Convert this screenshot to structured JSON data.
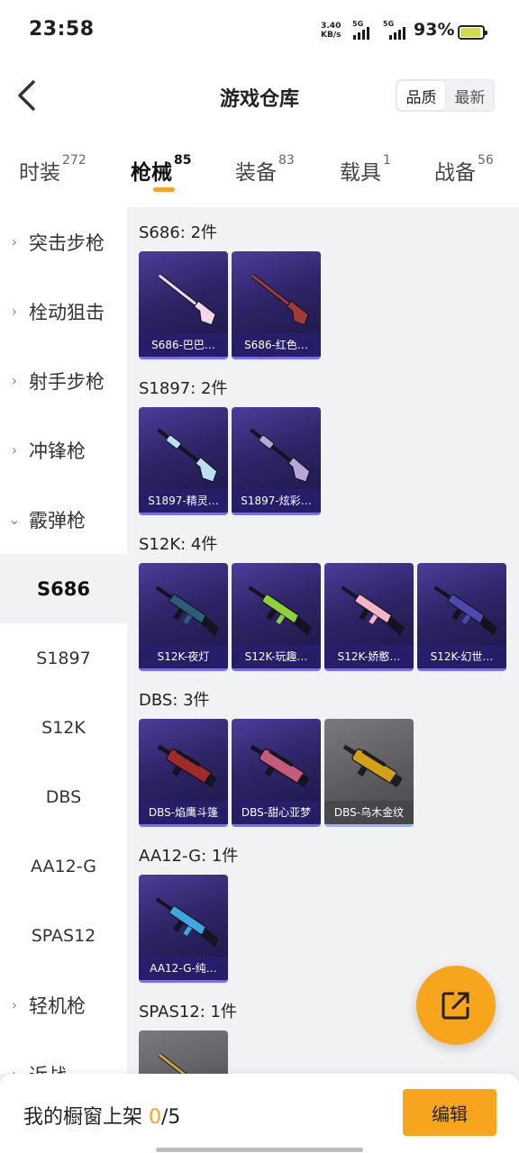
{
  "status_bar": {
    "time": "23:58",
    "net_speed": "3.40",
    "net_speed_unit": "KB/s",
    "sim1": "5G",
    "sim2": "5G",
    "battery_percent": "93%",
    "battery_level": 0.93
  },
  "header": {
    "title": "游戏仓库",
    "sort_options": [
      "品质",
      "最新"
    ],
    "active_sort": "品质"
  },
  "tabs": [
    {
      "label": "时装",
      "count": "272"
    },
    {
      "label": "枪械",
      "count": "85"
    },
    {
      "label": "装备",
      "count": "83"
    },
    {
      "label": "载具",
      "count": "1"
    },
    {
      "label": "战备",
      "count": "56"
    }
  ],
  "active_tab": "枪械",
  "sidebar": {
    "items": [
      {
        "label": "突击步枪",
        "type": "category",
        "expanded": false
      },
      {
        "label": "栓动狙击",
        "type": "category",
        "expanded": false
      },
      {
        "label": "射手步枪",
        "type": "category",
        "expanded": false
      },
      {
        "label": "冲锋枪",
        "type": "category",
        "expanded": false
      },
      {
        "label": "霰弹枪",
        "type": "category",
        "expanded": true
      },
      {
        "label": "S686",
        "type": "sub",
        "active": true
      },
      {
        "label": "S1897",
        "type": "sub",
        "active": false
      },
      {
        "label": "S12K",
        "type": "sub",
        "active": false
      },
      {
        "label": "DBS",
        "type": "sub",
        "active": false
      },
      {
        "label": "AA12-G",
        "type": "sub",
        "active": false
      },
      {
        "label": "SPAS12",
        "type": "sub",
        "active": false
      },
      {
        "label": "轻机枪",
        "type": "category",
        "expanded": false
      },
      {
        "label": "近战",
        "type": "category",
        "expanded": false
      }
    ]
  },
  "groups": [
    {
      "title": "S686: 2件",
      "items": [
        {
          "name": "S686-巴巴…",
          "tone": "purple",
          "gun": "shotgun",
          "color": "#f0d8e8"
        },
        {
          "name": "S686-红色…",
          "tone": "purple",
          "gun": "shotgun",
          "color": "#a33a3a"
        }
      ]
    },
    {
      "title": "S1897: 2件",
      "items": [
        {
          "name": "S1897-精灵…",
          "tone": "purple",
          "gun": "pump",
          "color": "#b8e0f0"
        },
        {
          "name": "S1897-炫彩…",
          "tone": "purple",
          "gun": "pump",
          "color": "#b7a6d8"
        }
      ]
    },
    {
      "title": "S12K: 4件",
      "items": [
        {
          "name": "S12K-夜灯",
          "tone": "purple",
          "gun": "rifle",
          "color": "#2e5d7a"
        },
        {
          "name": "S12K-玩趣…",
          "tone": "purple",
          "gun": "rifle",
          "color": "#8ed23a"
        },
        {
          "name": "S12K-娇憨…",
          "tone": "purple",
          "gun": "rifle",
          "color": "#f2b6c6"
        },
        {
          "name": "S12K-幻世…",
          "tone": "purple",
          "gun": "rifle",
          "color": "#4a4ab0"
        }
      ]
    },
    {
      "title": "DBS: 3件",
      "items": [
        {
          "name": "DBS-焰鹰斗篷",
          "tone": "purple",
          "gun": "bullpup",
          "color": "#a02a2a"
        },
        {
          "name": "DBS-甜心亚梦",
          "tone": "purple",
          "gun": "bullpup",
          "color": "#c45b78"
        },
        {
          "name": "DBS-乌木金纹",
          "tone": "gray",
          "gun": "bullpup",
          "color": "#d4a017"
        }
      ]
    },
    {
      "title": "AA12-G: 1件",
      "items": [
        {
          "name": "AA12-G-纯…",
          "tone": "purple",
          "gun": "rifle",
          "color": "#3fa6e0"
        }
      ]
    },
    {
      "title": "SPAS12: 1件",
      "items": [
        {
          "name": "",
          "tone": "gray",
          "gun": "shotgun",
          "color": "#c9a24a"
        }
      ]
    }
  ],
  "bottom_bar": {
    "shelf_label": "我的橱窗上架",
    "shelf_count": "0",
    "shelf_total": "/5",
    "edit_label": "编辑"
  }
}
